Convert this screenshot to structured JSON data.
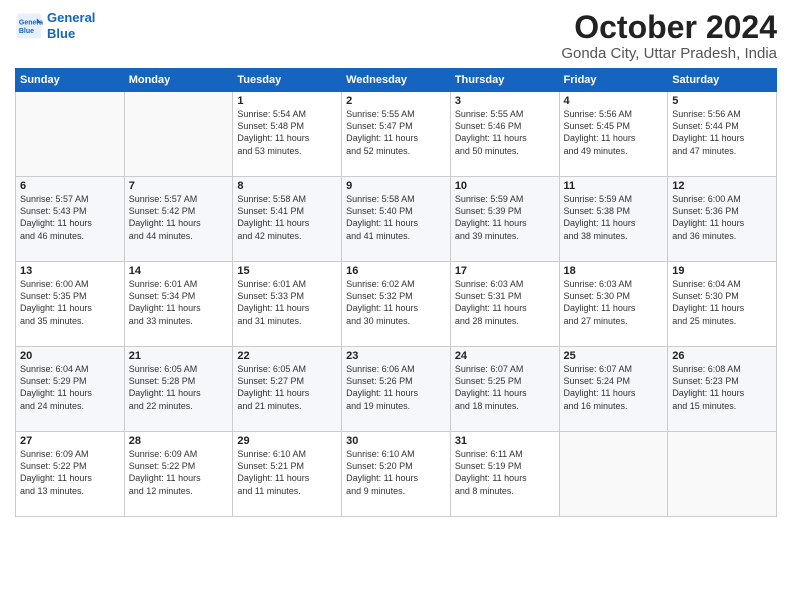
{
  "header": {
    "logo_line1": "General",
    "logo_line2": "Blue",
    "month": "October 2024",
    "location": "Gonda City, Uttar Pradesh, India"
  },
  "days_of_week": [
    "Sunday",
    "Monday",
    "Tuesday",
    "Wednesday",
    "Thursday",
    "Friday",
    "Saturday"
  ],
  "weeks": [
    [
      {
        "day": "",
        "info": ""
      },
      {
        "day": "",
        "info": ""
      },
      {
        "day": "1",
        "info": "Sunrise: 5:54 AM\nSunset: 5:48 PM\nDaylight: 11 hours\nand 53 minutes."
      },
      {
        "day": "2",
        "info": "Sunrise: 5:55 AM\nSunset: 5:47 PM\nDaylight: 11 hours\nand 52 minutes."
      },
      {
        "day": "3",
        "info": "Sunrise: 5:55 AM\nSunset: 5:46 PM\nDaylight: 11 hours\nand 50 minutes."
      },
      {
        "day": "4",
        "info": "Sunrise: 5:56 AM\nSunset: 5:45 PM\nDaylight: 11 hours\nand 49 minutes."
      },
      {
        "day": "5",
        "info": "Sunrise: 5:56 AM\nSunset: 5:44 PM\nDaylight: 11 hours\nand 47 minutes."
      }
    ],
    [
      {
        "day": "6",
        "info": "Sunrise: 5:57 AM\nSunset: 5:43 PM\nDaylight: 11 hours\nand 46 minutes."
      },
      {
        "day": "7",
        "info": "Sunrise: 5:57 AM\nSunset: 5:42 PM\nDaylight: 11 hours\nand 44 minutes."
      },
      {
        "day": "8",
        "info": "Sunrise: 5:58 AM\nSunset: 5:41 PM\nDaylight: 11 hours\nand 42 minutes."
      },
      {
        "day": "9",
        "info": "Sunrise: 5:58 AM\nSunset: 5:40 PM\nDaylight: 11 hours\nand 41 minutes."
      },
      {
        "day": "10",
        "info": "Sunrise: 5:59 AM\nSunset: 5:39 PM\nDaylight: 11 hours\nand 39 minutes."
      },
      {
        "day": "11",
        "info": "Sunrise: 5:59 AM\nSunset: 5:38 PM\nDaylight: 11 hours\nand 38 minutes."
      },
      {
        "day": "12",
        "info": "Sunrise: 6:00 AM\nSunset: 5:36 PM\nDaylight: 11 hours\nand 36 minutes."
      }
    ],
    [
      {
        "day": "13",
        "info": "Sunrise: 6:00 AM\nSunset: 5:35 PM\nDaylight: 11 hours\nand 35 minutes."
      },
      {
        "day": "14",
        "info": "Sunrise: 6:01 AM\nSunset: 5:34 PM\nDaylight: 11 hours\nand 33 minutes."
      },
      {
        "day": "15",
        "info": "Sunrise: 6:01 AM\nSunset: 5:33 PM\nDaylight: 11 hours\nand 31 minutes."
      },
      {
        "day": "16",
        "info": "Sunrise: 6:02 AM\nSunset: 5:32 PM\nDaylight: 11 hours\nand 30 minutes."
      },
      {
        "day": "17",
        "info": "Sunrise: 6:03 AM\nSunset: 5:31 PM\nDaylight: 11 hours\nand 28 minutes."
      },
      {
        "day": "18",
        "info": "Sunrise: 6:03 AM\nSunset: 5:30 PM\nDaylight: 11 hours\nand 27 minutes."
      },
      {
        "day": "19",
        "info": "Sunrise: 6:04 AM\nSunset: 5:30 PM\nDaylight: 11 hours\nand 25 minutes."
      }
    ],
    [
      {
        "day": "20",
        "info": "Sunrise: 6:04 AM\nSunset: 5:29 PM\nDaylight: 11 hours\nand 24 minutes."
      },
      {
        "day": "21",
        "info": "Sunrise: 6:05 AM\nSunset: 5:28 PM\nDaylight: 11 hours\nand 22 minutes."
      },
      {
        "day": "22",
        "info": "Sunrise: 6:05 AM\nSunset: 5:27 PM\nDaylight: 11 hours\nand 21 minutes."
      },
      {
        "day": "23",
        "info": "Sunrise: 6:06 AM\nSunset: 5:26 PM\nDaylight: 11 hours\nand 19 minutes."
      },
      {
        "day": "24",
        "info": "Sunrise: 6:07 AM\nSunset: 5:25 PM\nDaylight: 11 hours\nand 18 minutes."
      },
      {
        "day": "25",
        "info": "Sunrise: 6:07 AM\nSunset: 5:24 PM\nDaylight: 11 hours\nand 16 minutes."
      },
      {
        "day": "26",
        "info": "Sunrise: 6:08 AM\nSunset: 5:23 PM\nDaylight: 11 hours\nand 15 minutes."
      }
    ],
    [
      {
        "day": "27",
        "info": "Sunrise: 6:09 AM\nSunset: 5:22 PM\nDaylight: 11 hours\nand 13 minutes."
      },
      {
        "day": "28",
        "info": "Sunrise: 6:09 AM\nSunset: 5:22 PM\nDaylight: 11 hours\nand 12 minutes."
      },
      {
        "day": "29",
        "info": "Sunrise: 6:10 AM\nSunset: 5:21 PM\nDaylight: 11 hours\nand 11 minutes."
      },
      {
        "day": "30",
        "info": "Sunrise: 6:10 AM\nSunset: 5:20 PM\nDaylight: 11 hours\nand 9 minutes."
      },
      {
        "day": "31",
        "info": "Sunrise: 6:11 AM\nSunset: 5:19 PM\nDaylight: 11 hours\nand 8 minutes."
      },
      {
        "day": "",
        "info": ""
      },
      {
        "day": "",
        "info": ""
      }
    ]
  ]
}
